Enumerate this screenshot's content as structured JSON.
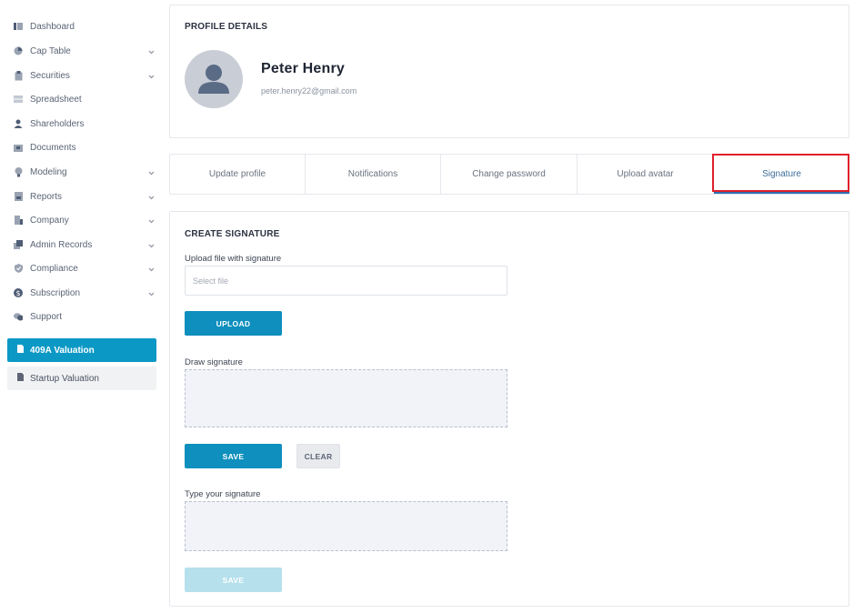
{
  "sidebar": {
    "items": [
      {
        "label": "Dashboard",
        "icon": "dashboard-icon",
        "chevron": false
      },
      {
        "label": "Cap Table",
        "icon": "pie-chart-icon",
        "chevron": true
      },
      {
        "label": "Securities",
        "icon": "clipboard-icon",
        "chevron": true
      },
      {
        "label": "Spreadsheet",
        "icon": "spreadsheet-icon",
        "chevron": false
      },
      {
        "label": "Shareholders",
        "icon": "person-icon",
        "chevron": false
      },
      {
        "label": "Documents",
        "icon": "folder-icon",
        "chevron": false
      },
      {
        "label": "Modeling",
        "icon": "lightbulb-icon",
        "chevron": true
      },
      {
        "label": "Reports",
        "icon": "report-icon",
        "chevron": true
      },
      {
        "label": "Company",
        "icon": "building-icon",
        "chevron": true
      },
      {
        "label": "Admin Records",
        "icon": "records-icon",
        "chevron": true
      },
      {
        "label": "Compliance",
        "icon": "shield-icon",
        "chevron": true
      },
      {
        "label": "Subscription",
        "icon": "dollar-icon",
        "chevron": true
      },
      {
        "label": "Support",
        "icon": "chat-icon",
        "chevron": false
      }
    ],
    "valuation_active": "409A Valuation",
    "valuation_other": "Startup Valuation"
  },
  "profile": {
    "section_title": "PROFILE DETAILS",
    "name": "Peter Henry",
    "email": "peter.henry22@gmail.com"
  },
  "tabs": [
    {
      "label": "Update profile"
    },
    {
      "label": "Notifications"
    },
    {
      "label": "Change password"
    },
    {
      "label": "Upload avatar"
    },
    {
      "label": "Signature"
    }
  ],
  "signature": {
    "section_title": "CREATE SIGNATURE",
    "upload_label": "Upload file with signature",
    "file_placeholder": "Select file",
    "upload_button": "UPLOAD",
    "draw_label": "Draw signature",
    "save_button": "SAVE",
    "clear_button": "CLEAR",
    "type_label": "Type your signature",
    "save_typed_button": "SAVE"
  },
  "colors": {
    "accent": "#0e8fbd",
    "active_tab": "#3d6d9a",
    "highlight": "#e0202a"
  }
}
